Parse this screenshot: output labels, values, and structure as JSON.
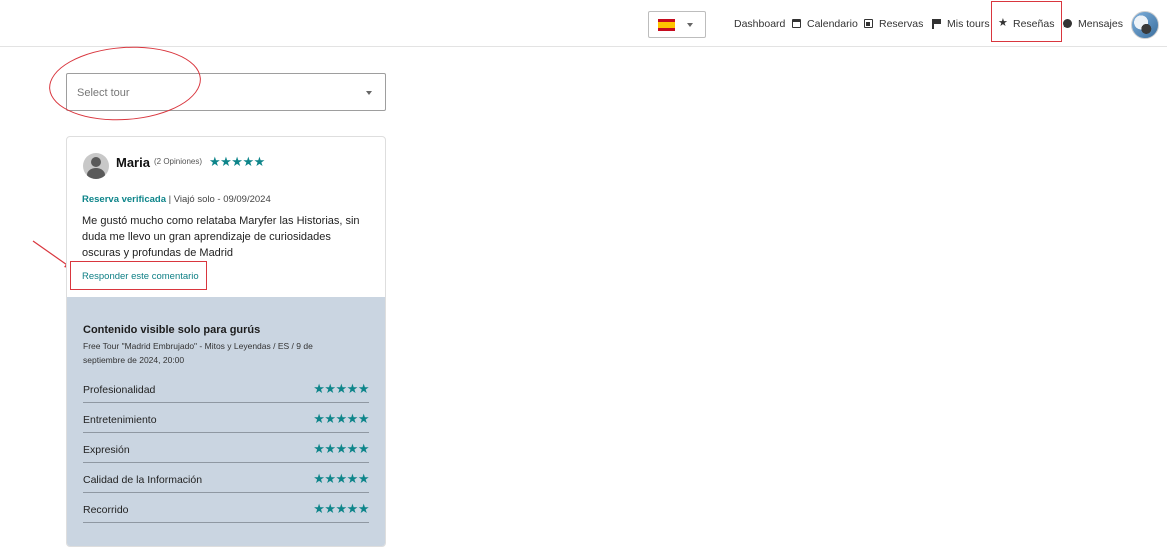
{
  "header": {
    "language_flag": "spain-flag-icon",
    "nav": {
      "dashboard": "Dashboard",
      "calendario": "Calendario",
      "reservas": "Reservas",
      "mis_tours": "Mis tours",
      "resenas": "Reseñas",
      "mensajes": "Mensajes"
    }
  },
  "filter": {
    "placeholder": "Select tour"
  },
  "review": {
    "user_name": "Maria",
    "opinions": "(2 Opiniones)",
    "stars": "★★★★★",
    "rating": 5,
    "verified_label": "Reserva verificada",
    "trip_info": " | Viajó solo - 09/09/2024",
    "text": "Me gustó mucho como relataba Maryfer las Historias, sin duda me llevo un gran aprendizaje de curiosidades oscuras y profundas de Madrid",
    "reply_link": "Responder este comentario"
  },
  "private": {
    "title": "Contenido visible solo para gurús",
    "subtitle": "Free Tour \"Madrid Embrujado\" - Mitos y Leyendas / ES / 9 de septiembre de 2024, 20:00",
    "ratings": [
      {
        "label": "Profesionalidad",
        "stars": "★★★★★",
        "value": 5
      },
      {
        "label": "Entretenimiento",
        "stars": "★★★★★",
        "value": 5
      },
      {
        "label": "Expresión",
        "stars": "★★★★★",
        "value": 5
      },
      {
        "label": "Calidad de la Información",
        "stars": "★★★★★",
        "value": 5
      },
      {
        "label": "Recorrido",
        "stars": "★★★★★",
        "value": 5
      }
    ]
  },
  "colors": {
    "accent": "#0e858a",
    "annotation": "#d9363e",
    "private_bg": "#cad5e1"
  }
}
